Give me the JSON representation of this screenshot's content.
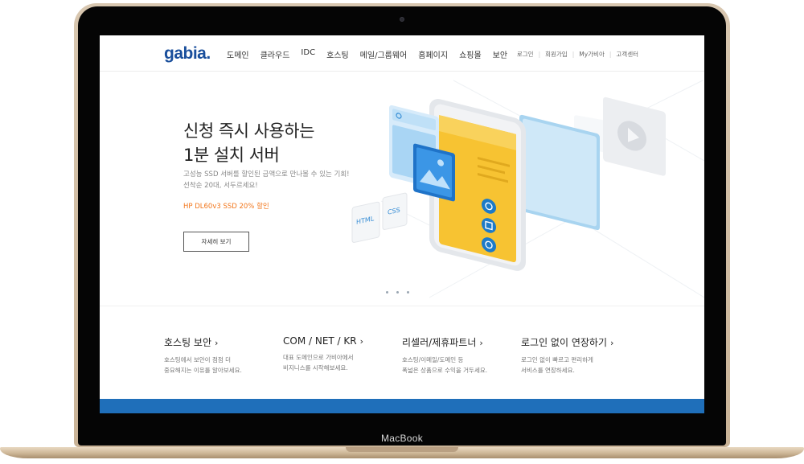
{
  "device": {
    "label": "MacBook"
  },
  "site": {
    "logo": "gabia.",
    "nav": [
      "도메인",
      "클라우드",
      "IDC",
      "호스팅",
      "메일/그룹웨어",
      "홈페이지",
      "쇼핑몰",
      "보안"
    ],
    "util": [
      "로그인",
      "회원가입",
      "My가비아",
      "고객센터"
    ]
  },
  "hero": {
    "title": "신청 즉시 사용하는\n1분 설치 서버",
    "desc": "고성능 SSD 서버를 할인된 금액으로 만나볼 수 있는 기회!\n선착순 20대, 서두르세요!",
    "promo": "HP DL60v3 SSD 20% 할인",
    "button": "자세히 보기",
    "illus_labels": {
      "html": "HTML",
      "css": "CSS"
    }
  },
  "features": [
    {
      "title": "호스팅 보안",
      "desc": "호스팅에서 보안이 점점 더\n중요해지는 이유를 알아보세요."
    },
    {
      "title": "COM / NET / KR",
      "desc": "대표 도메인으로 가비아에서\n비지니스를 시작해보세요."
    },
    {
      "title": "리셀러/제휴파트너",
      "desc": "호스팅/이메일/도메인 등\n폭넓은 상품으로 수익을 거두세요."
    },
    {
      "title": "로그인 없이 연장하기",
      "desc": "로그인 없이 빠르고 편리하게\n서비스를 연장하세요."
    }
  ],
  "colors": {
    "brand": "#1a4f9c",
    "promo": "#f2761b",
    "bar": "#1f6fba"
  }
}
